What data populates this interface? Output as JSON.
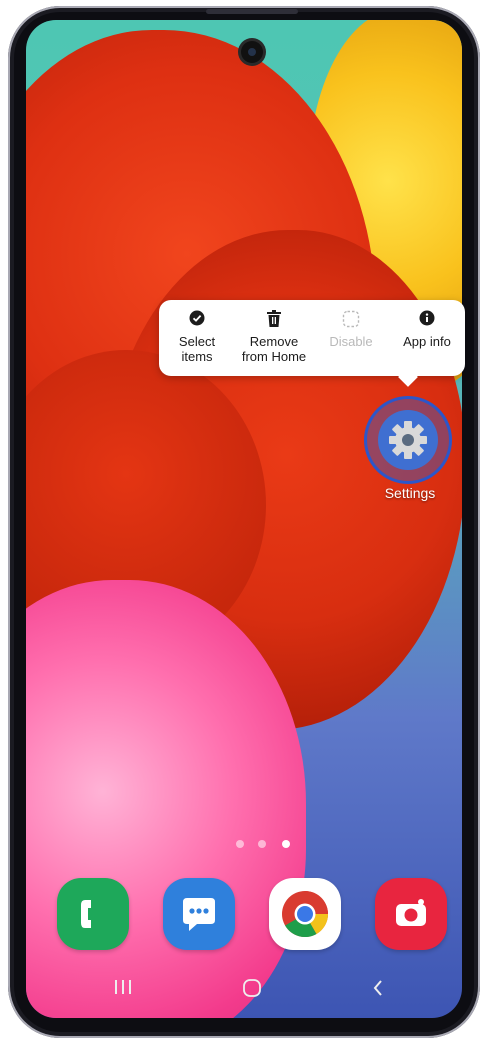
{
  "context_menu": {
    "items": [
      {
        "label_line1": "Select",
        "label_line2": "items",
        "icon": "check-circle-icon",
        "enabled": true
      },
      {
        "label_line1": "Remove",
        "label_line2": "from Home",
        "icon": "trash-icon",
        "enabled": true
      },
      {
        "label_line1": "Disable",
        "label_line2": "",
        "icon": "disable-dashed-icon",
        "enabled": false
      },
      {
        "label_line1": "App info",
        "label_line2": "",
        "icon": "info-icon",
        "enabled": true
      }
    ]
  },
  "home": {
    "selected_app": {
      "label": "Settings",
      "icon": "gear-icon",
      "color": "#3f6fd1"
    },
    "page_indicator": {
      "count": 3,
      "active_index": 2
    }
  },
  "dock": {
    "apps": [
      {
        "icon": "phone-icon",
        "color": "#1ea85a"
      },
      {
        "icon": "messages-icon",
        "color": "#2f80dc"
      },
      {
        "icon": "chrome-icon",
        "color": "#ffffff"
      },
      {
        "icon": "camera-icon",
        "color": "#e8253f"
      }
    ]
  },
  "navigation_bar": {
    "buttons": [
      "recents-icon",
      "home-icon",
      "back-icon"
    ]
  }
}
